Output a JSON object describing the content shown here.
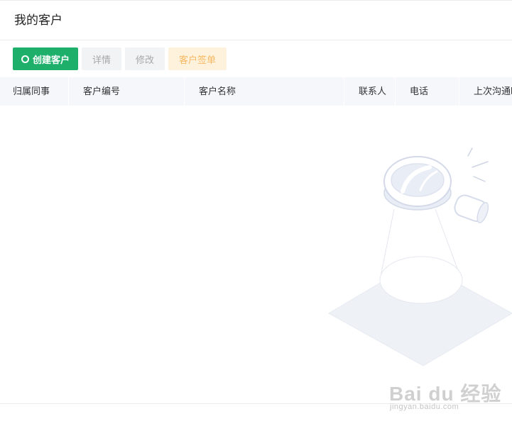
{
  "header": {
    "title": "我的客户"
  },
  "toolbar": {
    "create_label": "创建客户",
    "detail_label": "详情",
    "edit_label": "修改",
    "sign_label": "客户签单"
  },
  "table": {
    "columns": [
      "归属同事",
      "客户编号",
      "客户名称",
      "联系人",
      "电话",
      "上次沟通时"
    ]
  },
  "watermark": {
    "brand": "Bai du 经验",
    "url": "jingyan.baidu.com"
  },
  "colors": {
    "primary": "#1eb06b",
    "warning_bg": "#fff2dd",
    "warning_text": "#f5b962",
    "header_bg": "#f6f7fb"
  }
}
